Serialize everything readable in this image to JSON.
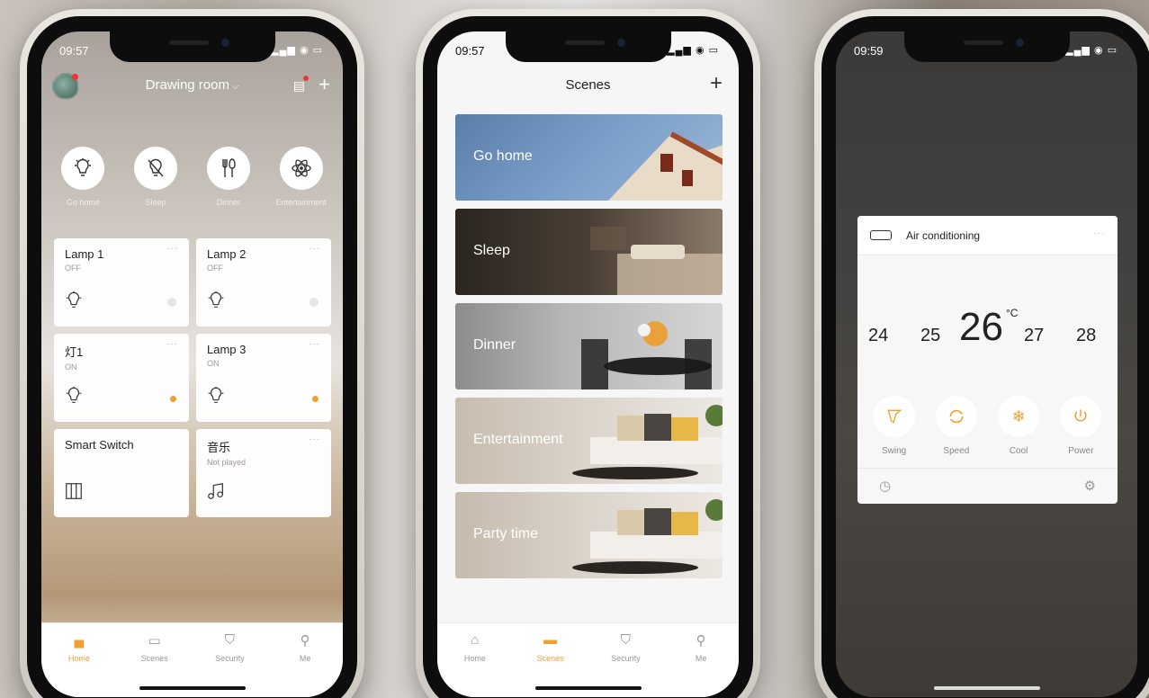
{
  "phone1": {
    "time": "09:57",
    "room_title": "Drawing room",
    "scenes": [
      {
        "label": "Go home",
        "icon": "bulb-icon"
      },
      {
        "label": "Sleep",
        "icon": "bulb-off-icon"
      },
      {
        "label": "Dinner",
        "icon": "cutlery-icon"
      },
      {
        "label": "Entertainment",
        "icon": "atom-icon"
      }
    ],
    "devices": [
      {
        "name": "Lamp 1",
        "status": "OFF",
        "state": "off"
      },
      {
        "name": "Lamp 2",
        "status": "OFF",
        "state": "off"
      },
      {
        "name": "灯1",
        "status": "ON",
        "state": "on"
      },
      {
        "name": "Lamp 3",
        "status": "ON",
        "state": "on"
      },
      {
        "name": "Smart Switch",
        "status": ""
      },
      {
        "name": "音乐",
        "status": "Not played"
      }
    ],
    "tabs": [
      "Home",
      "Scenes",
      "Security",
      "Me"
    ]
  },
  "phone2": {
    "time": "09:57",
    "title": "Scenes",
    "scenes": [
      "Go home",
      "Sleep",
      "Dinner",
      "Entertainment",
      "Party time"
    ],
    "tabs": [
      "Home",
      "Scenes",
      "Security",
      "Me"
    ]
  },
  "phone3": {
    "time": "09:59",
    "device_name": "Air conditioning",
    "temps": [
      "24",
      "25",
      "26",
      "27",
      "28"
    ],
    "unit": "°C",
    "controls": [
      "Swing",
      "Speed",
      "Cool",
      "Power"
    ]
  },
  "accent_color": "#f0a030"
}
